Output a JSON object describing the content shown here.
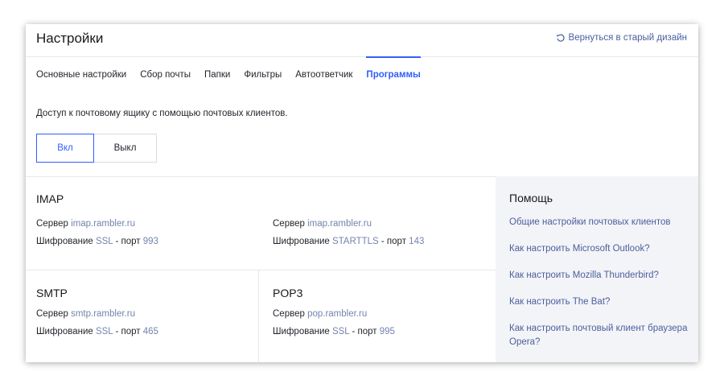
{
  "header": {
    "title": "Настройки",
    "old_design_link": "Вернуться в старый дизайн"
  },
  "tabs": [
    {
      "label": "Основные настройки"
    },
    {
      "label": "Сбор почты"
    },
    {
      "label": "Папки"
    },
    {
      "label": "Фильтры"
    },
    {
      "label": "Автоответчик"
    },
    {
      "label": "Программы",
      "active": true
    }
  ],
  "access": {
    "text": "Доступ к почтовому ящику с помощью почтовых клиентов.",
    "on_label": "Вкл",
    "off_label": "Выкл",
    "selected": "Вкл"
  },
  "labels": {
    "server": "Сервер",
    "encryption": "Шифрование",
    "port_sep": "- порт"
  },
  "imap": {
    "title": "IMAP",
    "col1": {
      "server": "imap.rambler.ru",
      "encryption": "SSL",
      "port": "993"
    },
    "col2": {
      "server": "imap.rambler.ru",
      "encryption": "STARTTLS",
      "port": "143"
    }
  },
  "smtp": {
    "title": "SMTP",
    "server": "smtp.rambler.ru",
    "encryption": "SSL",
    "port": "465"
  },
  "pop3": {
    "title": "POP3",
    "server": "pop.rambler.ru",
    "encryption": "SSL",
    "port": "995"
  },
  "help": {
    "title": "Помощь",
    "links": [
      "Общие настройки почтовых клиентов",
      "Как настроить Microsoft Outlook?",
      "Как настроить Mozilla Thunderbird?",
      "Как настроить The Bat?",
      "Как настроить почтовый клиент браузера Opera?"
    ]
  },
  "colors": {
    "accent": "#315efb",
    "link": "#4a5f9e",
    "value": "#7484ad",
    "help_bg": "#f3f4f7"
  }
}
